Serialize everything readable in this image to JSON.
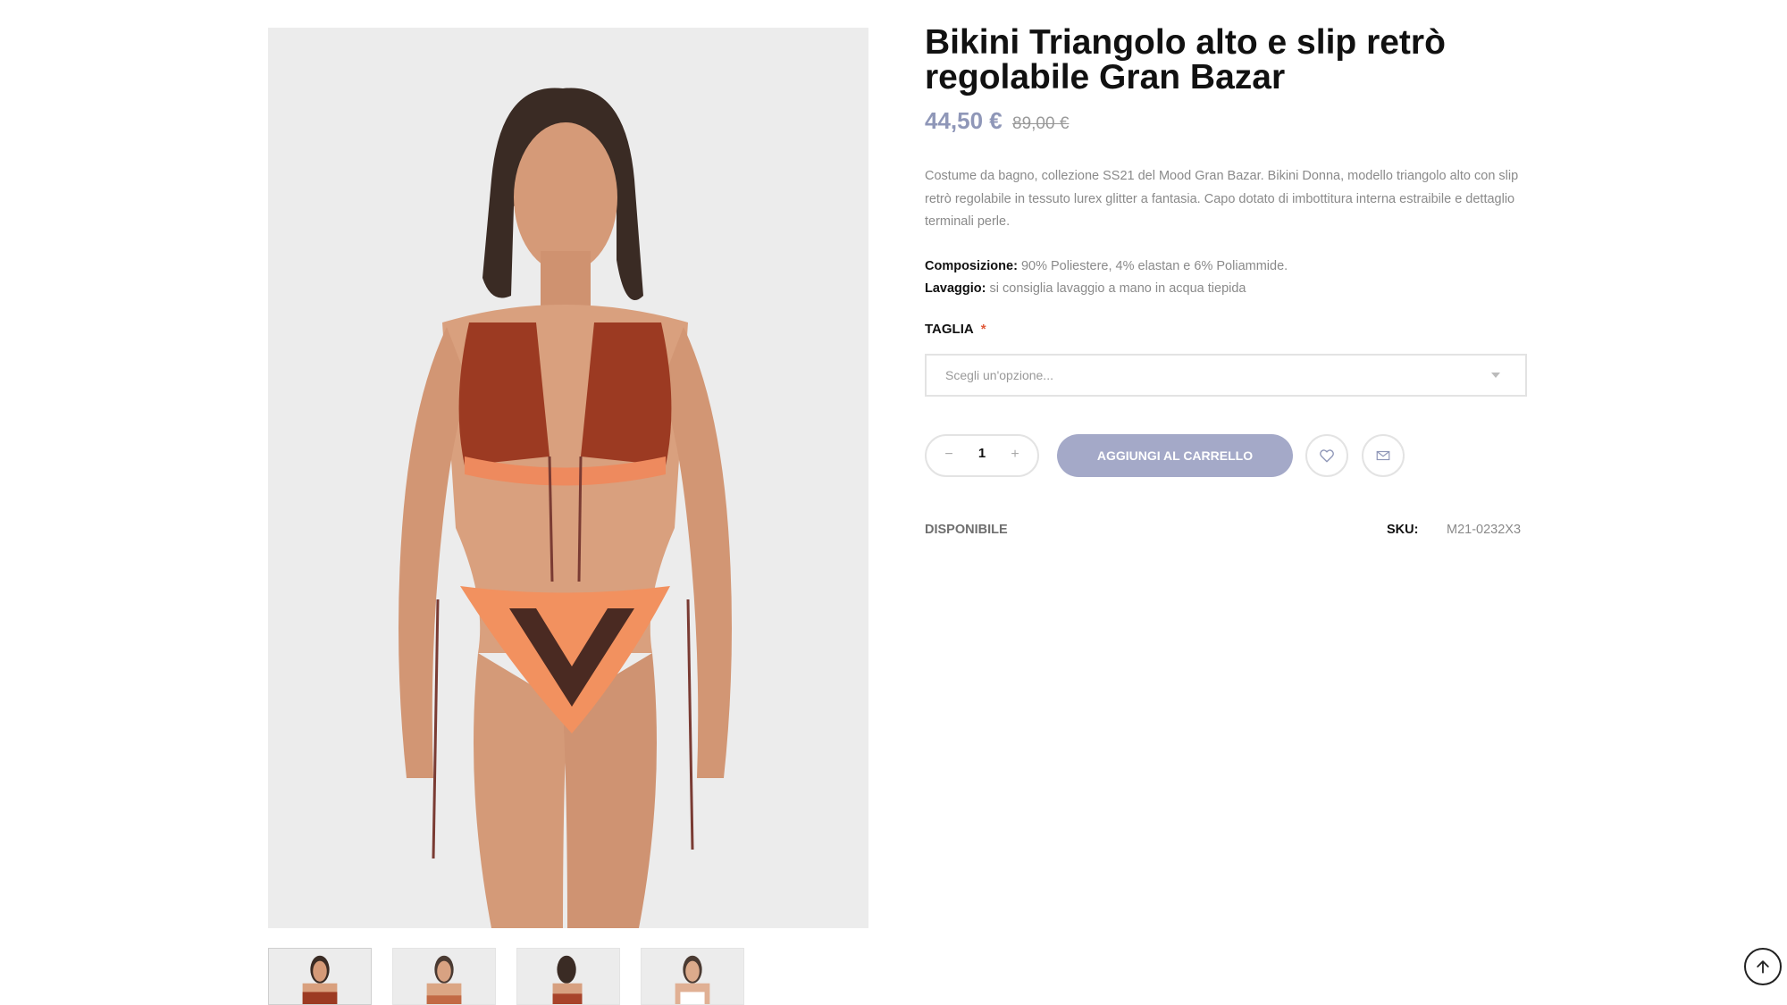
{
  "product": {
    "title": "Bikini Triangolo alto e slip retrò regolabile Gran Bazar",
    "price_current": "44,50 €",
    "price_old": "89,00 €",
    "description": "Costume da bagno, collezione SS21 del Mood Gran Bazar. Bikini Donna, modello triangolo alto con slip retrò regolabile in tessuto lurex glitter a fantasia. Capo dotato di imbottitura interna estraibile e dettaglio terminali perle.",
    "composition_label": "Composizione:",
    "composition_value": "90% Poliestere, 4% elastan e 6% Poliammide.",
    "washing_label": "Lavaggio:",
    "washing_value": "si consiglia lavaggio a mano in acqua tiepida",
    "size_label": "TAGLIA",
    "required_mark": "*",
    "size_select_placeholder": "Scegli un'opzione...",
    "quantity": "1",
    "qty_minus": "−",
    "qty_plus": "+",
    "add_to_cart_label": "AGGIUNGI AL CARRELLO",
    "availability": "DISPONIBILE",
    "sku_label": "SKU:",
    "sku_value": "M21-0232X3"
  },
  "gallery": {
    "thumbnail_count": 4,
    "active_thumbnail": 1
  },
  "colors": {
    "accent": "#a4a9c8",
    "price": "#8f97b8",
    "required": "#e05a3a"
  },
  "icons": [
    "heart-icon",
    "envelope-icon",
    "arrow-up-icon"
  ]
}
